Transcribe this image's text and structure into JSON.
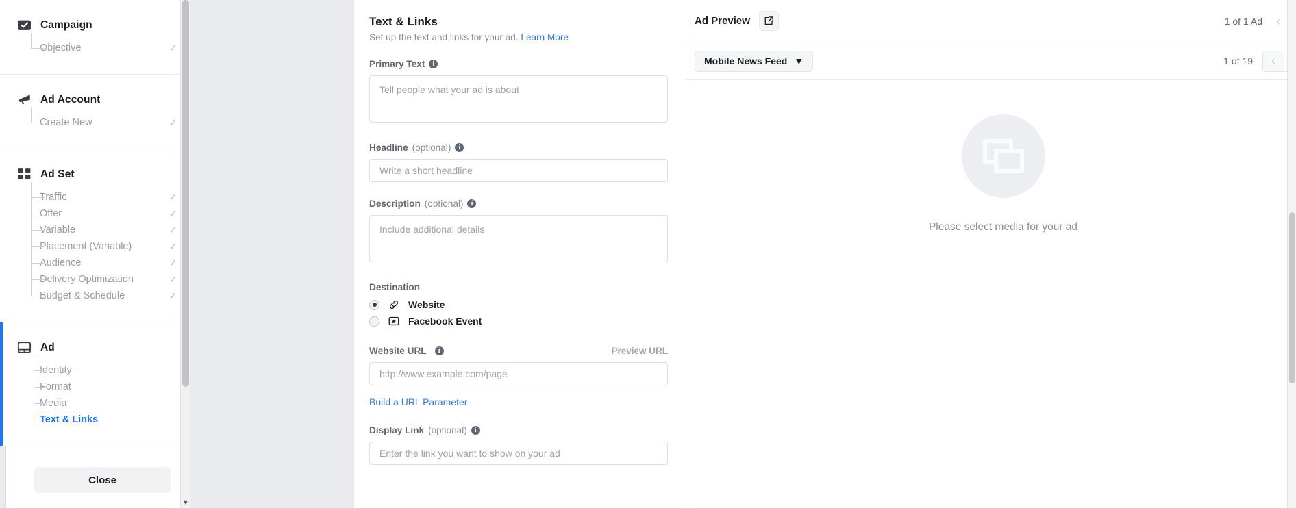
{
  "sidebar": {
    "sections": [
      {
        "title": "Campaign",
        "icon": "campaign-check-icon",
        "active": false,
        "items": [
          {
            "label": "Objective",
            "status": "✓",
            "current": false
          }
        ]
      },
      {
        "title": "Ad Account",
        "icon": "megaphone-icon",
        "active": false,
        "items": [
          {
            "label": "Create New",
            "status": "✓",
            "current": false
          }
        ]
      },
      {
        "title": "Ad Set",
        "icon": "grid-icon",
        "active": false,
        "items": [
          {
            "label": "Traffic",
            "status": "✓",
            "current": false
          },
          {
            "label": "Offer",
            "status": "✓",
            "current": false
          },
          {
            "label": "Variable",
            "status": "✓",
            "current": false
          },
          {
            "label": "Placement (Variable)",
            "status": "✓",
            "current": false
          },
          {
            "label": "Audience",
            "status": "✓",
            "current": false
          },
          {
            "label": "Delivery Optimization",
            "status": "✓",
            "current": false
          },
          {
            "label": "Budget & Schedule",
            "status": "✓",
            "current": false
          }
        ]
      },
      {
        "title": "Ad",
        "icon": "ad-window-icon",
        "active": true,
        "items": [
          {
            "label": "Identity",
            "status": "",
            "current": false
          },
          {
            "label": "Format",
            "status": "",
            "current": false
          },
          {
            "label": "Media",
            "status": "",
            "current": false
          },
          {
            "label": "Text & Links",
            "status": "",
            "current": true
          }
        ]
      }
    ],
    "close_label": "Close"
  },
  "form": {
    "title": "Text & Links",
    "subtitle": "Set up the text and links for your ad.",
    "learn_more": "Learn More",
    "primary_text": {
      "label": "Primary Text",
      "placeholder": "Tell people what your ad is about",
      "value": ""
    },
    "headline": {
      "label": "Headline",
      "optional": "(optional)",
      "placeholder": "Write a short headline",
      "value": ""
    },
    "description": {
      "label": "Description",
      "optional": "(optional)",
      "placeholder": "Include additional details",
      "value": ""
    },
    "destination": {
      "label": "Destination",
      "options": [
        {
          "label": "Website",
          "icon": "link-chain-icon",
          "selected": true
        },
        {
          "label": "Facebook Event",
          "icon": "event-star-icon",
          "selected": false
        }
      ]
    },
    "website_url": {
      "label": "Website URL",
      "preview_link": "Preview URL",
      "placeholder": "http://www.example.com/page",
      "value": ""
    },
    "build_url_parameter": "Build a URL Parameter",
    "display_link": {
      "label": "Display Link",
      "optional": "(optional)",
      "placeholder": "Enter the link you want to show on your ad",
      "value": ""
    }
  },
  "preview": {
    "title": "Ad Preview",
    "open_icon": "external-link-icon",
    "ad_count": "1 of 1 Ad",
    "placement_select": "Mobile News Feed",
    "page_count": "1 of 19",
    "empty_message": "Please select media for your ad"
  },
  "colors": {
    "accent": "#1877f2",
    "link": "#3578e5",
    "muted": "#8a8d91",
    "text": "#1c1e21",
    "panel_bg": "#e9ebee"
  }
}
